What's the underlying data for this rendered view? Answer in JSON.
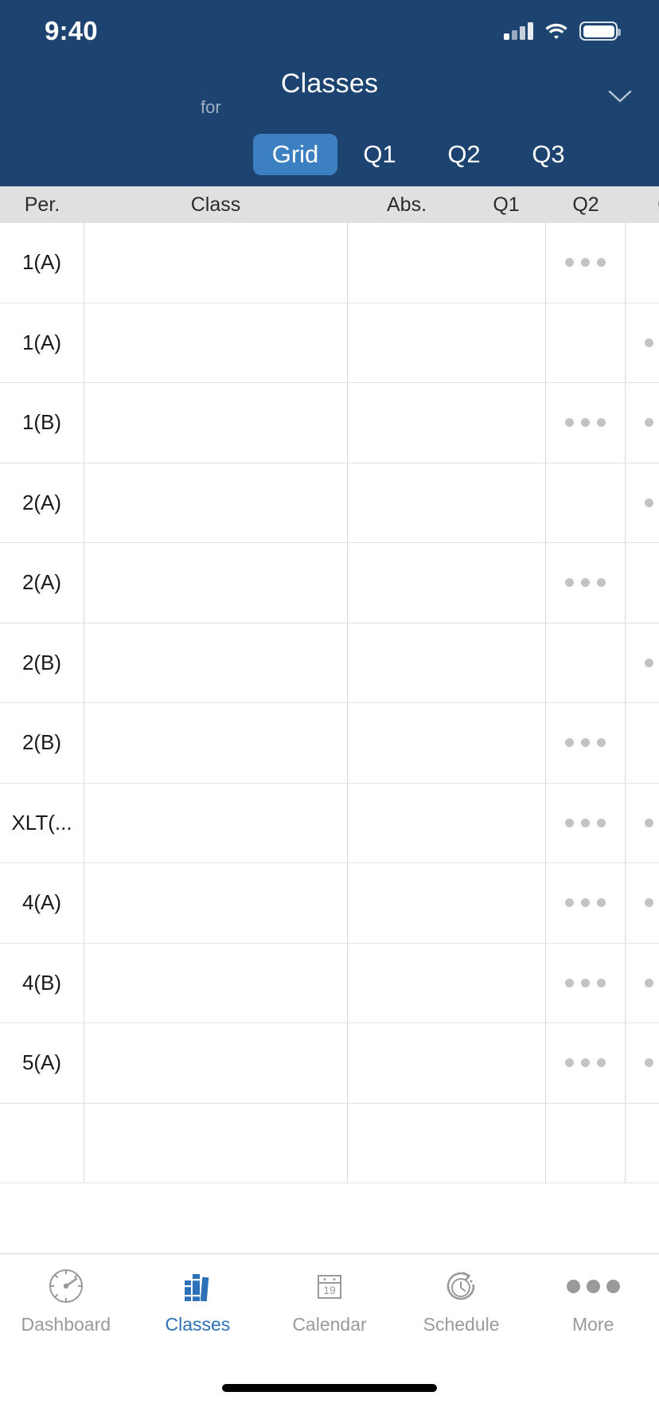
{
  "status_bar": {
    "time": "9:40",
    "signal_icon": "cellular-signal-icon",
    "wifi_icon": "wifi-icon",
    "battery_icon": "battery-icon"
  },
  "header": {
    "title": "Classes",
    "subtitle": "for",
    "chevron_icon": "chevron-down-icon",
    "background_color": "#1d4371",
    "accent_color": "#3d80c2",
    "segments": [
      {
        "label": "Grid",
        "active": true
      },
      {
        "label": "Q1",
        "active": false
      },
      {
        "label": "Q2",
        "active": false
      },
      {
        "label": "Q3",
        "active": false
      }
    ]
  },
  "table": {
    "columns": [
      "Per.",
      "Class",
      "Abs.",
      "Q1",
      "Q2",
      "Q"
    ],
    "rows": [
      {
        "per": "1(A)",
        "class": "",
        "abs": "",
        "q1": "",
        "q2": "dots",
        "q3": ""
      },
      {
        "per": "1(A)",
        "class": "",
        "abs": "",
        "q1": "",
        "q2": "",
        "q3": "dots"
      },
      {
        "per": "1(B)",
        "class": "",
        "abs": "",
        "q1": "",
        "q2": "dots",
        "q3": "dots"
      },
      {
        "per": "2(A)",
        "class": "",
        "abs": "",
        "q1": "",
        "q2": "",
        "q3": "dots"
      },
      {
        "per": "2(A)",
        "class": "",
        "abs": "",
        "q1": "",
        "q2": "dots",
        "q3": ""
      },
      {
        "per": "2(B)",
        "class": "",
        "abs": "",
        "q1": "",
        "q2": "",
        "q3": "dots"
      },
      {
        "per": "2(B)",
        "class": "",
        "abs": "",
        "q1": "",
        "q2": "dots",
        "q3": ""
      },
      {
        "per": "XLT(...",
        "class": "",
        "abs": "",
        "q1": "",
        "q2": "dots",
        "q3": "dots"
      },
      {
        "per": "4(A)",
        "class": "",
        "abs": "",
        "q1": "",
        "q2": "dots",
        "q3": "dots"
      },
      {
        "per": "4(B)",
        "class": "",
        "abs": "",
        "q1": "",
        "q2": "dots",
        "q3": "dots"
      },
      {
        "per": "5(A)",
        "class": "",
        "abs": "",
        "q1": "",
        "q2": "dots",
        "q3": "dots"
      },
      {
        "per": "",
        "class": "",
        "abs": "",
        "q1": "",
        "q2": "",
        "q3": ""
      }
    ]
  },
  "tabbar": {
    "active_color": "#2d71b8",
    "inactive_color": "#9a9a9a",
    "items": [
      {
        "label": "Dashboard",
        "icon": "gauge-icon",
        "active": false
      },
      {
        "label": "Classes",
        "icon": "books-icon",
        "active": true
      },
      {
        "label": "Calendar",
        "icon": "calendar-icon",
        "active": false,
        "day": "19"
      },
      {
        "label": "Schedule",
        "icon": "clock-arrow-icon",
        "active": false
      },
      {
        "label": "More",
        "icon": "ellipsis-icon",
        "active": false
      }
    ]
  }
}
